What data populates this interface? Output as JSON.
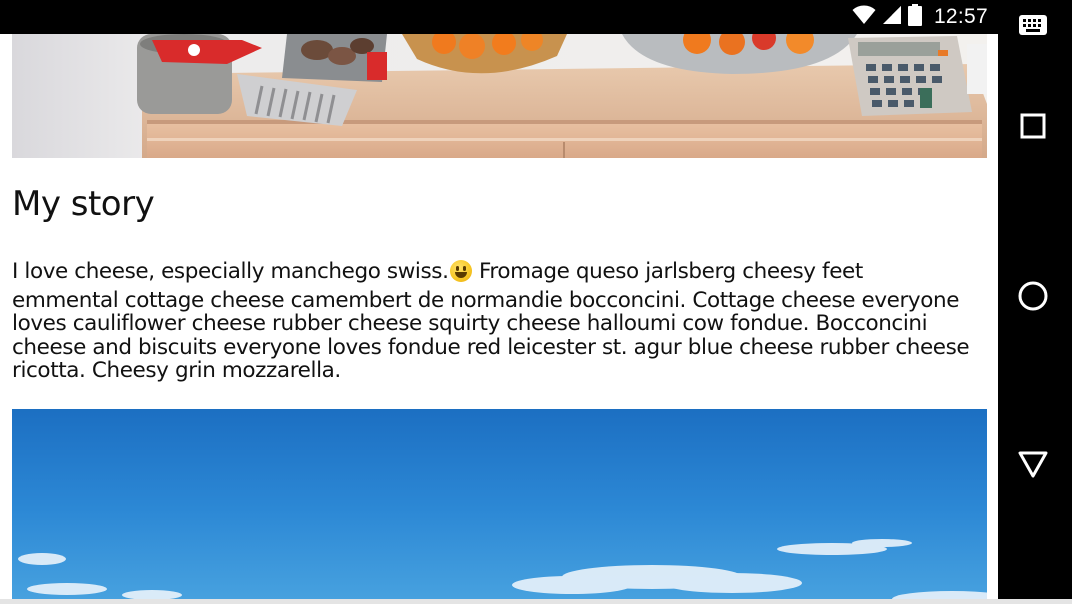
{
  "status_bar": {
    "time": "12:57",
    "icons": [
      "wifi-icon",
      "cell-signal-icon",
      "battery-icon"
    ]
  },
  "nav_bar": {
    "buttons": [
      "keyboard-icon",
      "recents-icon",
      "home-icon",
      "back-icon"
    ]
  },
  "article": {
    "heading": "My story",
    "paragraph_line1_before_emoji": "I love cheese, especially manchego swiss.",
    "paragraph_line1_after_emoji": " Fromage queso jarlsberg cheesy feet",
    "paragraph_rest": "emmental cottage cheese camembert de normandie bocconcini. Cottage cheese everyone loves cauliflower cheese rubber cheese squirty cheese halloumi cow fondue. Bocconcini cheese and biscuits everyone loves fondue red leicester st. agur blue cheese rubber cheese ricotta. Cheesy grin mozzarella.",
    "emoji": "grinning-face-emoji",
    "top_image": "kitchen-counter-photo",
    "bottom_image": "blue-sky-photo"
  },
  "colors": {
    "status_bar_bg": "#000000",
    "nav_bar_bg": "#000000",
    "page_bg": "#ffffff",
    "text": "#111111",
    "sky": "#2b86d4"
  }
}
